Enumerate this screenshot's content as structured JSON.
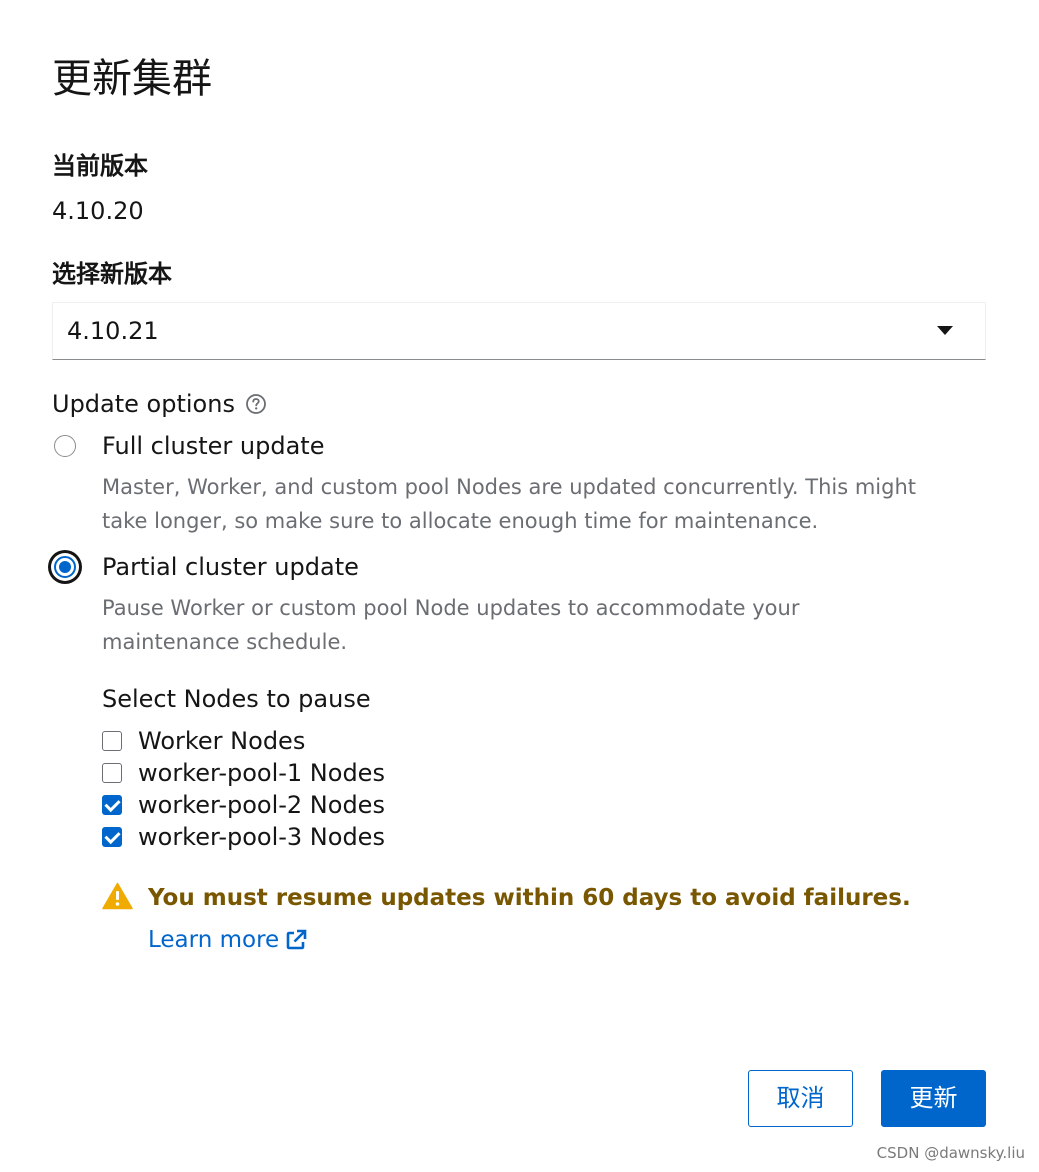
{
  "modal": {
    "title": "更新集群"
  },
  "current_version": {
    "label": "当前版本",
    "value": "4.10.20"
  },
  "new_version": {
    "label": "选择新版本",
    "selected": "4.10.21"
  },
  "update_options": {
    "label": "Update options",
    "help_icon": "question-circle-icon",
    "options": [
      {
        "label": "Full cluster update",
        "description": "Master, Worker, and custom pool Nodes are updated concurrently. This might take longer, so make sure to allocate enough time for maintenance.",
        "checked": false
      },
      {
        "label": "Partial cluster update",
        "description": "Pause Worker or custom pool Node updates to accommodate your maintenance schedule.",
        "checked": true
      }
    ]
  },
  "pause_nodes": {
    "label": "Select Nodes to pause",
    "items": [
      {
        "label": "Worker Nodes",
        "checked": false
      },
      {
        "label": "worker-pool-1 Nodes",
        "checked": false
      },
      {
        "label": "worker-pool-2 Nodes",
        "checked": true
      },
      {
        "label": "worker-pool-3 Nodes",
        "checked": true
      }
    ]
  },
  "alert": {
    "icon": "warning-triangle-icon",
    "title": "You must resume updates within 60 days to avoid failures.",
    "link_label": "Learn more",
    "link_icon": "external-link-icon",
    "color": "#795600",
    "icon_color": "#f0ab00"
  },
  "footer": {
    "cancel_label": "取消",
    "submit_label": "更新"
  },
  "watermark": "CSDN @dawnsky.liu",
  "colors": {
    "accent": "#0066cc",
    "text": "#151515",
    "muted": "#6a6e73"
  }
}
